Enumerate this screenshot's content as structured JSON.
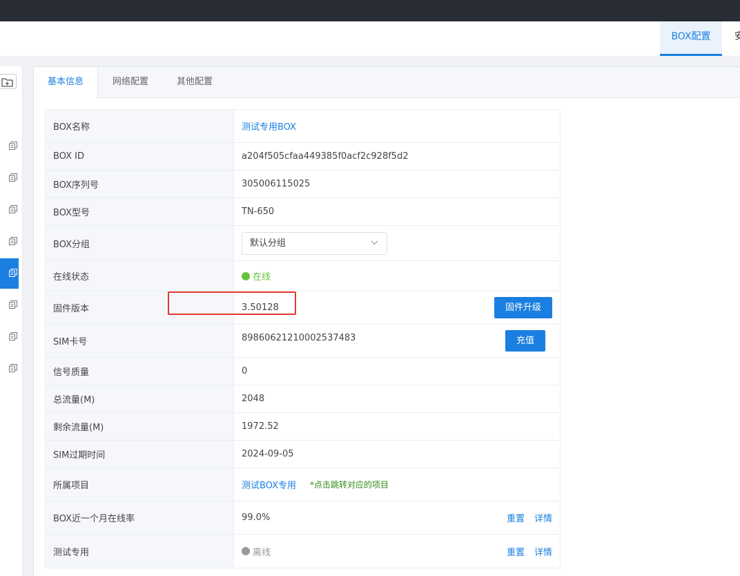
{
  "header": {
    "tabs": [
      "BOX配置",
      "安"
    ]
  },
  "sidebar": {
    "folder_icon": "folder-add-icon",
    "item_icon": "copy-icon",
    "active_index": 4
  },
  "panel": {
    "tabs": [
      "基本信息",
      "网络配置",
      "其他配置"
    ],
    "active_tab": "基本信息"
  },
  "info": {
    "box_name_label": "BOX名称",
    "box_name": "测试专用BOX",
    "box_id_label": "BOX ID",
    "box_id": "a204f505cfaa449385f0acf2c928f5d2",
    "serial_label": "BOX序列号",
    "serial": "305006115025",
    "model_label": "BOX型号",
    "model": "TN-650",
    "group_label": "BOX分组",
    "group_value": "默认分组",
    "status_label": "在线状态",
    "status_value": "在线",
    "status_color": "#67c23a",
    "firmware_label": "固件版本",
    "firmware_value": "3.50128",
    "firmware_button": "固件升级",
    "sim_label": "SIM卡号",
    "sim_value": "89860621210002537483",
    "sim_button": "充值",
    "signal_label": "信号质量",
    "signal_value": "0",
    "total_label": "总流量(M)",
    "total_value": "2048",
    "remain_label": "剩余流量(M)",
    "remain_value": "1972.52",
    "expire_label": "SIM过期时间",
    "expire_value": "2024-09-05",
    "project_label": "所属项目",
    "project_value": "测试BOX专用",
    "project_note": "*点击跳转对应的项目",
    "rate_label": "BOX近一个月在线率",
    "rate_value": "99.0%",
    "reset_label": "重置",
    "detail_label": "详情",
    "test_label": "测试专用",
    "test_value": "离线",
    "offline_color": "#999999"
  }
}
